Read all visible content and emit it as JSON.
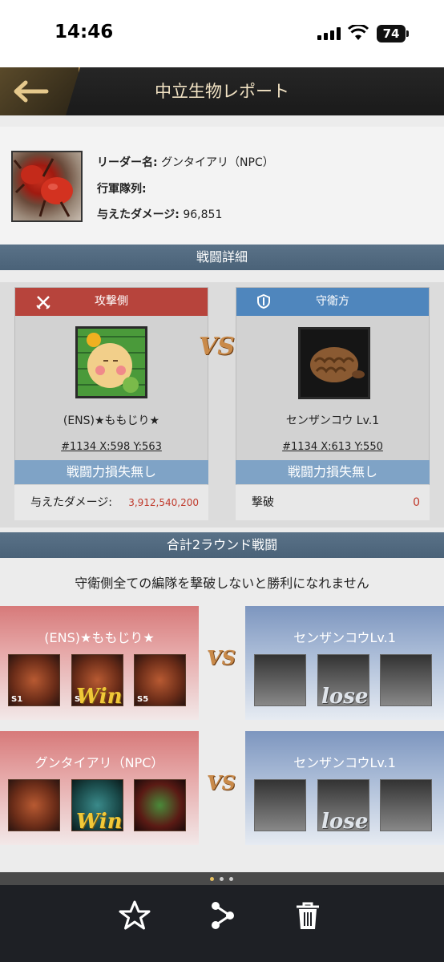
{
  "status_bar": {
    "time": "14:46",
    "battery": "74"
  },
  "header": {
    "title": "中立生物レポート"
  },
  "leader": {
    "rows": [
      {
        "label": "リーダー名:",
        "value": "グンタイアリ（NPC）"
      },
      {
        "label": "行軍隊列:",
        "value": ""
      },
      {
        "label": "与えたダメージ:",
        "value": "96,851"
      }
    ]
  },
  "battle_detail": {
    "section_title": "戦闘詳細",
    "vs": "VS",
    "attacker": {
      "side_label": "攻撃側",
      "name": "(ENS)★ももじり★",
      "coords": "#1134  X:598  Y:563",
      "loss_text": "戦闘力損失無し",
      "stat_label": "与えたダメージ:",
      "stat_value": "3,912,540,200"
    },
    "defender": {
      "side_label": "守衛方",
      "name": "センザンコウ Lv.1",
      "coords": "#1134  X:613  Y:550",
      "loss_text": "戦闘力損失無し",
      "stat_label": "撃破",
      "stat_value": "0"
    }
  },
  "rounds": {
    "section_title": "合計2ラウンド戦闘",
    "note": "守衛側全ての編隊を撃破しないと勝利になれません",
    "list": [
      {
        "attacker_name": "(ENS)★ももじり★",
        "defender_name": "センザンコウLv.1",
        "vs": "VS",
        "attacker_slot_labels": [
          "S1",
          "S",
          "S5"
        ],
        "win_text": "Win",
        "lose_text": "lose"
      },
      {
        "attacker_name": "グンタイアリ（NPC）",
        "defender_name": "センザンコウLv.1",
        "vs": "VS",
        "attacker_slot_labels": [
          "",
          "",
          ""
        ],
        "win_text": "Win",
        "lose_text": "lose"
      }
    ]
  },
  "colors": {
    "attacker_red": "#b7443c",
    "defender_blue": "#4f86bd",
    "damage_red": "#c0392b",
    "section_blue": "#4f6880"
  },
  "icons": [
    "back-arrow-icon",
    "swords-icon",
    "shield-icon",
    "star-icon",
    "share-icon",
    "trash-icon"
  ],
  "pager": {
    "page_count": 3,
    "active_index": 0
  }
}
